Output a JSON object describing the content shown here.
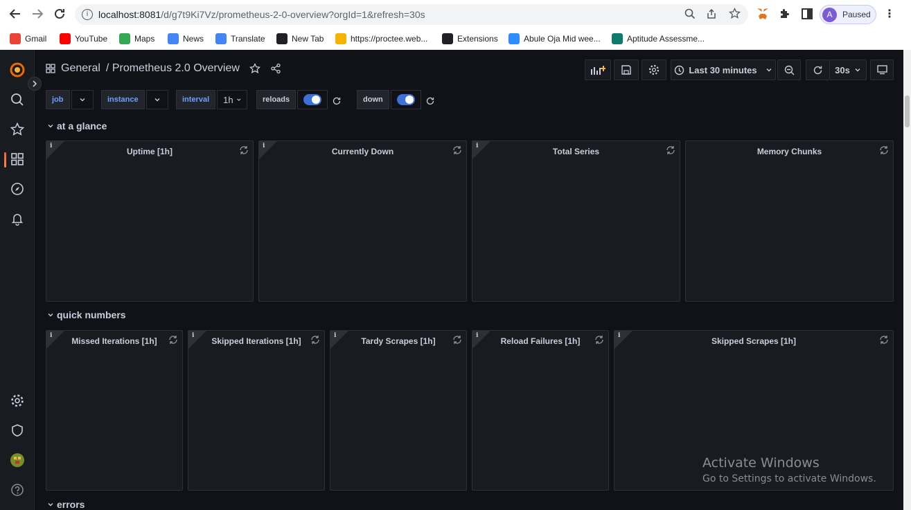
{
  "browser": {
    "url_host": "localhost:8081",
    "url_path": "/d/g7t9Ki7Vz/prometheus-2-0-overview?orgId=1&refresh=30s",
    "profile_initial": "A",
    "profile_label": "Paused",
    "bookmarks": [
      {
        "label": "Gmail",
        "icon": "gmail-icon",
        "color": "#ea4335"
      },
      {
        "label": "YouTube",
        "icon": "youtube-icon",
        "color": "#ff0000"
      },
      {
        "label": "Maps",
        "icon": "maps-icon",
        "color": "#34a853"
      },
      {
        "label": "News",
        "icon": "news-icon",
        "color": "#4285f4"
      },
      {
        "label": "Translate",
        "icon": "translate-icon",
        "color": "#4285f4"
      },
      {
        "label": "New Tab",
        "icon": "globe-icon",
        "color": "#202124"
      },
      {
        "label": "https://proctee.web...",
        "icon": "proctee-icon",
        "color": "#f4b400"
      },
      {
        "label": "Extensions",
        "icon": "puzzle-icon",
        "color": "#202124"
      },
      {
        "label": "Abule Oja Mid wee...",
        "icon": "zoom-icon",
        "color": "#2d8cff"
      },
      {
        "label": "Aptitude Assessme...",
        "icon": "forms-icon",
        "color": "#0f7b6c"
      }
    ]
  },
  "dashboard": {
    "folder": "General",
    "title": "/ Prometheus 2.0 Overview",
    "time_range": "Last 30 minutes",
    "refresh": "30s"
  },
  "variables": {
    "job_label": "job",
    "instance_label": "instance",
    "interval_label": "interval",
    "interval_value": "1h",
    "reloads_label": "reloads",
    "down_label": "down"
  },
  "rows": [
    {
      "title": "at a glance"
    },
    {
      "title": "quick numbers"
    },
    {
      "title": "errors"
    }
  ],
  "glance_panels": [
    "Uptime [1h]",
    "Currently Down",
    "Total Series",
    "Memory Chunks"
  ],
  "quick_panels": [
    "Missed Iterations [1h]",
    "Skipped Iterations [1h]",
    "Tardy Scrapes [1h]",
    "Reload Failures [1h]",
    "Skipped Scrapes [1h]"
  ],
  "watermark": {
    "line1": "Activate Windows",
    "line2": "Go to Settings to activate Windows."
  },
  "colors": {
    "accent": "#3d71d9",
    "variable_label": "#6e9fff",
    "grafana_orange": "#f55f3e"
  }
}
